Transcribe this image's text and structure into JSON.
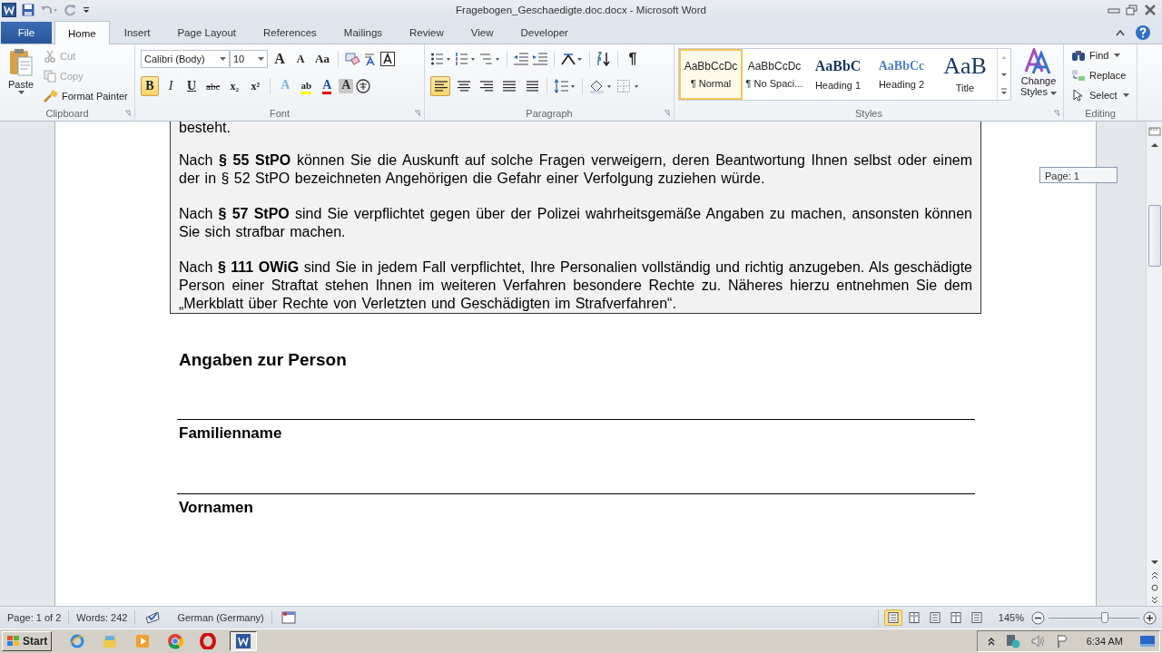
{
  "window": {
    "title": "Fragebogen_Geschaedigte.doc.docx  -  Microsoft Word"
  },
  "tabs": [
    {
      "label": "File",
      "kind": "file",
      "selected": false
    },
    {
      "label": "Home",
      "kind": "tab",
      "selected": true
    },
    {
      "label": "Insert",
      "kind": "tab",
      "selected": false
    },
    {
      "label": "Page Layout",
      "kind": "tab",
      "selected": false
    },
    {
      "label": "References",
      "kind": "tab",
      "selected": false
    },
    {
      "label": "Mailings",
      "kind": "tab",
      "selected": false
    },
    {
      "label": "Review",
      "kind": "tab",
      "selected": false
    },
    {
      "label": "View",
      "kind": "tab",
      "selected": false
    },
    {
      "label": "Developer",
      "kind": "tab",
      "selected": false
    }
  ],
  "clipboard": {
    "label": "Clipboard",
    "paste": "Paste",
    "items": [
      {
        "label": "Cut",
        "kind": "cut",
        "disabled": true
      },
      {
        "label": "Copy",
        "kind": "copy",
        "disabled": true
      },
      {
        "label": "Format Painter",
        "kind": "painter",
        "disabled": false
      }
    ]
  },
  "font": {
    "label": "Font",
    "font_name": "Calibri (Body)",
    "font_size": "10",
    "size_tools": [
      {
        "glyph": "A",
        "kind": "grow"
      },
      {
        "glyph": "A",
        "kind": "shrink"
      },
      {
        "glyph": "Aa",
        "kind": "case"
      }
    ],
    "format_buttons": [
      {
        "glyph": "B",
        "kind": "bold",
        "selected": true
      },
      {
        "glyph": "I",
        "kind": "italic",
        "selected": false
      },
      {
        "glyph": "U",
        "kind": "underline",
        "selected": false
      },
      {
        "glyph": "abc",
        "kind": "strike",
        "selected": false
      },
      {
        "glyph": "x₂",
        "kind": "sub",
        "selected": false
      },
      {
        "glyph": "x²",
        "kind": "sup",
        "selected": false
      }
    ],
    "color_buttons": [
      {
        "glyph": "A",
        "kind": "effects"
      },
      {
        "glyph": "ab",
        "kind": "highlight"
      },
      {
        "glyph": "A",
        "kind": "color"
      },
      {
        "glyph": "A",
        "kind": "shading"
      }
    ]
  },
  "paragraph": {
    "label": "Paragraph",
    "show_marks": "¶",
    "alignments": [
      {
        "kind": "left",
        "selected": true
      },
      {
        "kind": "center",
        "selected": false
      },
      {
        "kind": "right",
        "selected": false
      },
      {
        "kind": "justify",
        "selected": false
      },
      {
        "kind": "distributed",
        "selected": false
      }
    ]
  },
  "styles": {
    "label": "Styles",
    "change_styles": "Change Styles",
    "items": [
      {
        "preview": "AaBbCcDc",
        "name": "¶ Normal",
        "kind": "normal",
        "selected": true
      },
      {
        "preview": "AaBbCcDc",
        "name": "¶ No Spaci...",
        "kind": "normal",
        "selected": false
      },
      {
        "preview": "AaBbC",
        "name": "Heading 1",
        "kind": "heading1",
        "selected": false
      },
      {
        "preview": "AaBbCc",
        "name": "Heading 2",
        "kind": "heading2",
        "selected": false
      },
      {
        "preview": "AaB",
        "name": "Title",
        "kind": "title",
        "selected": false
      }
    ]
  },
  "editing": {
    "label": "Editing",
    "items": [
      {
        "label": "Find",
        "kind": "find"
      },
      {
        "label": "Replace",
        "kind": "replace"
      },
      {
        "label": "Select",
        "kind": "select"
      }
    ]
  },
  "document": {
    "cut_line": "besteht.",
    "page_tip": "Page: 1",
    "paragraphs": [
      "Nach **§ 55 StPO** können Sie die Auskunft auf solche Fragen verweigern, deren Beantwortung Ihnen selbst oder einem der in § 52 StPO bezeichneten Angehörigen die Gefahr einer Verfolgung zuziehen würde.",
      "Nach **§ 57 StPO** sind Sie verpflichtet gegen über der Polizei wahrheitsgemäße Angaben zu machen, ansonsten können Sie sich strafbar machen.",
      "Nach **§ 111 OWiG** sind Sie in jedem Fall verpflichtet, Ihre Personalien vollständig und richtig anzugeben. Als geschädigte Person einer Straftat stehen Ihnen im weiteren Verfahren besondere Rechte zu. Näheres hierzu entnehmen Sie dem „Merkblatt über Rechte von Verletzten und Geschädigten im Strafverfahren“."
    ],
    "heading": "Angaben zur Person",
    "fields": [
      {
        "label": "Familienname"
      },
      {
        "label": "Vornamen"
      }
    ]
  },
  "status_bar": {
    "page": "Page: 1 of 2",
    "words": "Words: 242",
    "language": "German (Germany)",
    "zoom": "145%",
    "views": [
      {
        "selected": true
      },
      {
        "selected": false
      },
      {
        "selected": false
      },
      {
        "selected": false
      },
      {
        "selected": false
      }
    ],
    "zoom_slider": {
      "level": 0.62
    }
  },
  "taskbar": {
    "start": "Start",
    "clock": "6:34 AM",
    "apps": [
      {
        "kind": "ie",
        "selected": false
      },
      {
        "kind": "explorer",
        "selected": false
      },
      {
        "kind": "media",
        "selected": false
      },
      {
        "kind": "chrome",
        "selected": false
      },
      {
        "kind": "opera",
        "selected": false
      },
      {
        "kind": "word",
        "selected": true
      }
    ]
  }
}
